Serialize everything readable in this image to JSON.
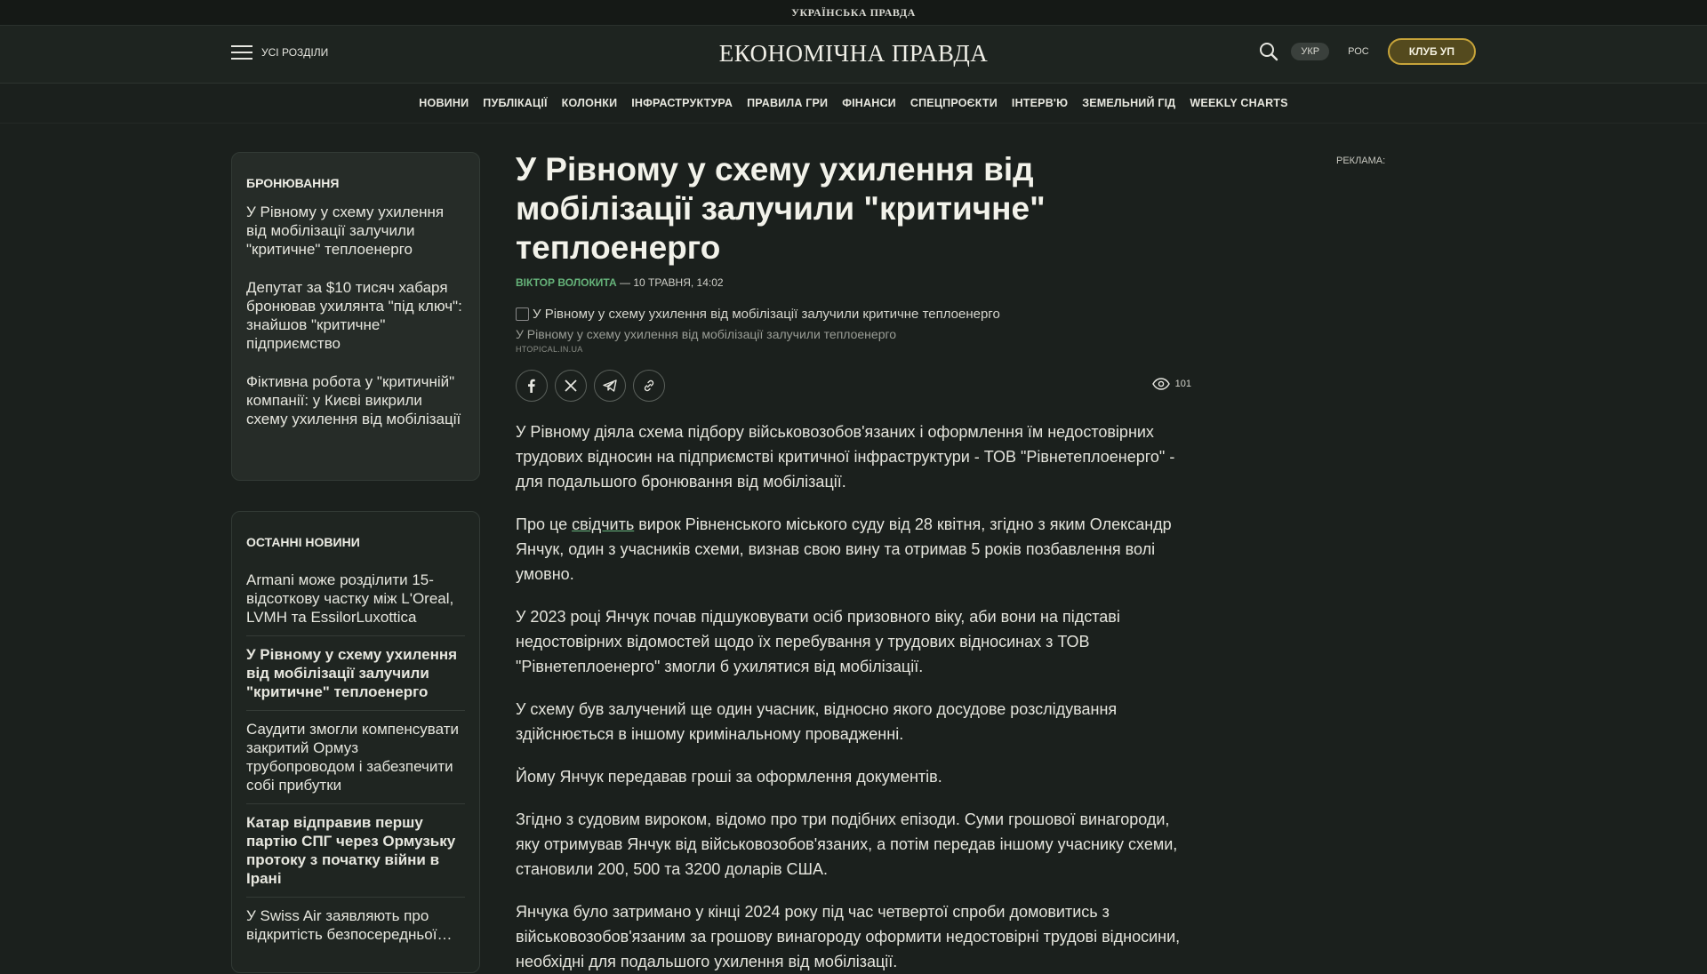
{
  "topbar": {
    "brand": "УКРАЇНСЬКА ПРАВДА"
  },
  "header": {
    "menu_label": "УСІ РОЗДІЛИ",
    "logo": "ЕКОНОМІЧНА ПРАВДА",
    "lang_ukr": "УКР",
    "lang_ros": "РОС",
    "club": "КЛУБ УП"
  },
  "nav": [
    "НОВИНИ",
    "ПУБЛІКАЦІЇ",
    "КОЛОНКИ",
    "ІНФРАСТРУКТУРА",
    "ПРАВИЛА ГРИ",
    "ФІНАНСИ",
    "СПЕЦПРОЄКТИ",
    "ІНТЕРВ'Ю",
    "ЗЕМЕЛЬНИЙ ГІД",
    "WEEKLY CHARTS"
  ],
  "sidebar_related": {
    "title": "БРОНЮВАННЯ",
    "items": [
      "У Рівному у схему ухилення від мобілізації залучили \"критичне\" теплоенерго",
      "Депутат за $10 тисяч хабаря бронював ухилянта \"під ключ\": знайшов \"критичне\" підприємство",
      "Фіктивна робота у \"критичній\" компанії: у Києві викрили схему ухилення від мобілізації"
    ]
  },
  "sidebar_latest": {
    "title": "ОСТАННІ НОВИНИ",
    "items": [
      "Armani може розділити 15-відсоткову частку між L'Oreal, LVMH та EssilorLuxottica",
      "У Рівному у схему ухилення від мобілізації залучили \"критичне\" теплоенерго",
      "Саудити змогли компенсувати закритий Ормуз трубопроводом і забезпечити собі прибутки",
      "Катар відправив першу партію СПГ через Ормузьку протоку з початку війни в Ірані",
      "У Swiss Air заявляють про відкритість безпосередньої…"
    ]
  },
  "article": {
    "title": "У Рівному у схему ухилення від мобілізації залучили \"критичне\" теплоенерго",
    "author": "ВІКТОР ВОЛОКИТА",
    "date": " — 10 ТРАВНЯ, 14:02",
    "image_alt": "У Рівному у схему ухилення від мобілізації залучили критичне теплоенерго",
    "caption": "У Рівному у схему ухилення від мобілізації залучили теплоенерго",
    "source": "HTOPICAL.IN.UA",
    "views": "101",
    "p1": "У Рівному діяла схема підбору військовозобов'язаних і оформлення їм недостовірних трудових відносин на підприємстві критичної інфраструктури - ТОВ \"Рівнетеплоенерго\" - для подальшого бронювання від мобілізації.",
    "p2_before": "Про це ",
    "p2_link": "свідчить",
    "p2_after": " вирок Рівненського міського суду від 28 квітня, згідно з яким Олександр Янчук, один з учасників схеми, визнав свою вину та отримав 5 років позбавлення волі умовно.",
    "p3": "У 2023 році Янчук почав підшуковувати осіб призовного віку, аби вони на підставі недостовірних відомостей щодо їх перебування у трудових відносинах з ТОВ \"Рівнетеплоенерго\" змогли б ухилятися від мобілізації.",
    "p4": "У схему був залучений ще один учасник, відносно якого досудове розслідування здійснюється в іншому кримінальному провадженні.",
    "p5": "Йому Янчук передавав гроші за оформлення документів.",
    "p6": "Згідно з судовим вироком, відомо про три подібних епізоди. Суми грошової винагороди, яку отримував Янчук від військовозобов'язаних, а потім передав іншому учаснику схеми, становили 200, 500 та 3200 доларів США.",
    "p7": "Янчука було затримано у кінці 2024 року під час четвертої спроби домовитись з військовозобов'язаним за грошову винагороду оформити недостовірні трудові відносини, необхідні для подальшого ухилення від мобілізації."
  },
  "ad": {
    "label": "РЕКЛАМА:"
  }
}
